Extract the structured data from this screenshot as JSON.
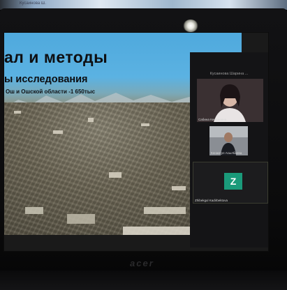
{
  "top_strip": {
    "text": "Кусаинова Ш."
  },
  "slide": {
    "title": "ал и методы",
    "subtitle": "ы исследования",
    "caption": "Ош и Ошской области -1 650тыс"
  },
  "participants": {
    "header": "Кусаинова Шарина ...",
    "tiles": [
      {
        "name": "Сабина Кенжеевна",
        "type": "video"
      },
      {
        "name": "Кенжегул Асылбаева",
        "type": "video"
      },
      {
        "name": "Zhibekgul Kadirbektova",
        "type": "avatar",
        "avatar_letter": "Z",
        "avatar_color": "#1a9a7a"
      }
    ]
  },
  "monitor": {
    "brand": "acer"
  },
  "colors": {
    "slide_sky": "#4fa9dd",
    "panel_bg": "#141416",
    "avatar_green": "#1a9a7a"
  }
}
